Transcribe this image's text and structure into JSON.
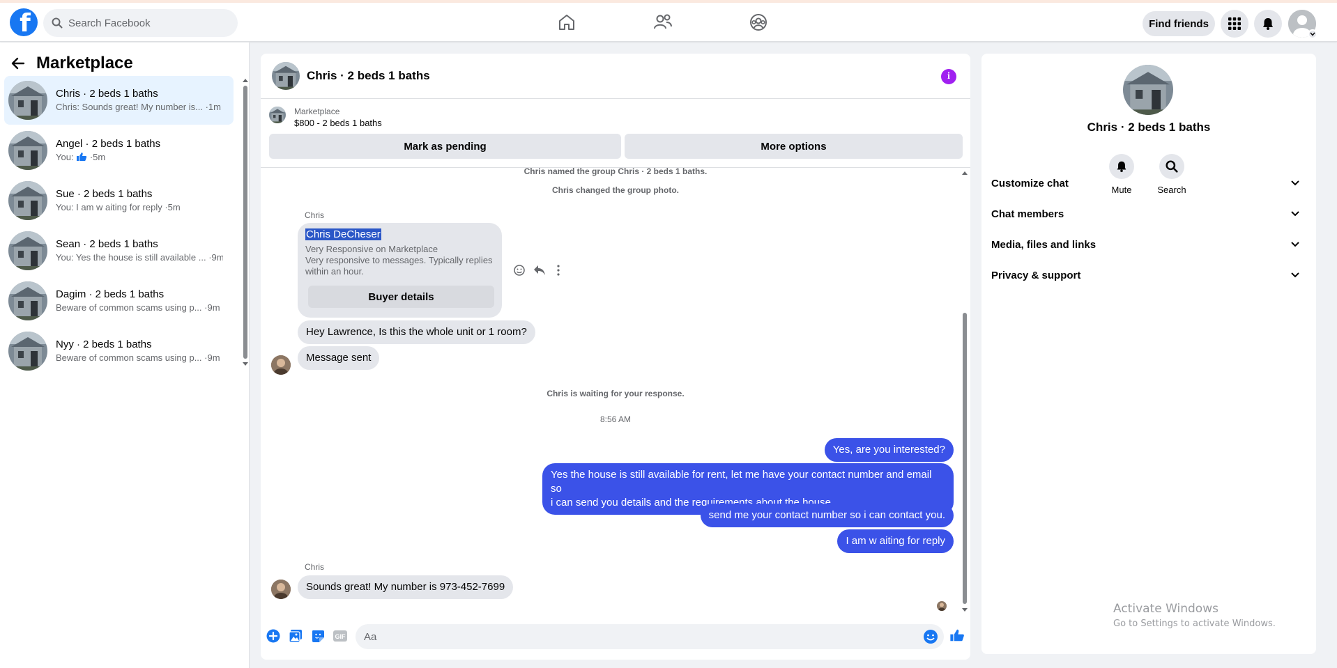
{
  "topbar": {
    "search_placeholder": "Search Facebook",
    "find_friends": "Find friends",
    "brand_color": "#1877f2"
  },
  "sidebar": {
    "title": "Marketplace",
    "conversations": [
      {
        "name": "Chris · 2 beds 1 baths",
        "preview": "Chris: Sounds great! My number is... ·1m",
        "active": true
      },
      {
        "name": "Angel · 2 beds 1 baths",
        "preview_prefix": "You:",
        "preview_icon": "thumbs-up-icon",
        "preview_suffix": "·5m"
      },
      {
        "name": "Sue · 2 beds 1 baths",
        "preview": "You: I am w aiting for reply ·5m"
      },
      {
        "name": "Sean · 2 beds 1 baths",
        "preview": "You: Yes the house is still available ... ·9m"
      },
      {
        "name": "Dagim · 2 beds 1 baths",
        "preview": "Beware of common scams using p... ·9m"
      },
      {
        "name": "Nyy · 2 beds 1 baths",
        "preview": "Beware of common scams using p... ·9m"
      }
    ]
  },
  "chat": {
    "title": "Chris · 2 beds 1 baths",
    "marketplace_label": "Marketplace",
    "listing": "$800 - 2 beds 1 baths",
    "mark_pending": "Mark as pending",
    "more_options": "More options",
    "system_1": "Chris named the group Chris · 2 beds 1 baths.",
    "system_2": "Chris changed the group photo.",
    "sender_1": "Chris",
    "card": {
      "name": "Chris DeCheser",
      "line1": "Very Responsive on Marketplace",
      "line2": "Very responsive to messages. Typically replies within an hour.",
      "button": "Buyer details"
    },
    "msg_in_1": "Hey Lawrence, Is this the whole unit or 1 room?",
    "msg_in_2": "Message sent",
    "waiting": "Chris is waiting for your response.",
    "time": "8:56 AM",
    "out_1": "Yes, are you interested?",
    "out_2a": "Yes the house is still available for rent, let me have your contact number and email so",
    "out_2b": "i can send you details and the requirements about the house",
    "out_3": "send me your contact number so i can contact you.",
    "out_4": "I am w aiting for reply",
    "sender_2": "Chris",
    "msg_in_3": "Sounds great! My number is 973-452-7699",
    "composer_placeholder": "Aa",
    "outgoing_color": "#3b52e8"
  },
  "rpanel": {
    "name": "Chris · 2 beds 1 baths",
    "mute": "Mute",
    "search": "Search",
    "items": [
      "Customize chat",
      "Chat members",
      "Media, files and links",
      "Privacy & support"
    ]
  },
  "watermark": {
    "line1": "Activate Windows",
    "line2": "Go to Settings to activate Windows."
  }
}
